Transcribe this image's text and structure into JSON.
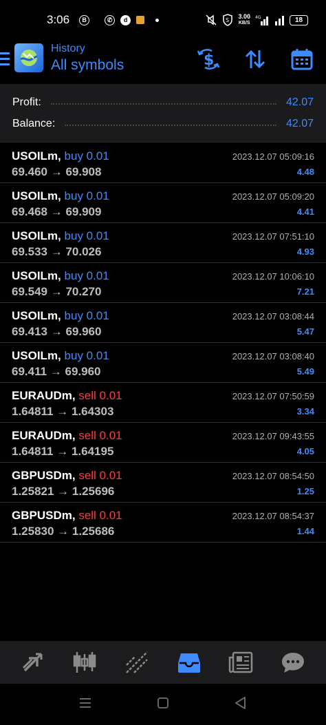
{
  "status_bar": {
    "time": "3:06",
    "network_speed_value": "3.00",
    "network_speed_unit": "KB/S",
    "network_type": "4G",
    "battery": "18"
  },
  "header": {
    "title_small": "History",
    "title_big": "All symbols"
  },
  "summary": {
    "profit_label": "Profit:",
    "profit_value": "42.07",
    "balance_label": "Balance:",
    "balance_value": "42.07"
  },
  "trades": [
    {
      "symbol": "USOILm,",
      "side": "buy 0.01",
      "type": "buy",
      "prices": "69.460 → 69.908",
      "date": "2023.12.07 05:09:16",
      "profit": "4.48"
    },
    {
      "symbol": "USOILm,",
      "side": "buy 0.01",
      "type": "buy",
      "prices": "69.468 → 69.909",
      "date": "2023.12.07 05:09:20",
      "profit": "4.41"
    },
    {
      "symbol": "USOILm,",
      "side": "buy 0.01",
      "type": "buy",
      "prices": "69.533 → 70.026",
      "date": "2023.12.07 07:51:10",
      "profit": "4.93"
    },
    {
      "symbol": "USOILm,",
      "side": "buy 0.01",
      "type": "buy",
      "prices": "69.549 → 70.270",
      "date": "2023.12.07 10:06:10",
      "profit": "7.21"
    },
    {
      "symbol": "USOILm,",
      "side": "buy 0.01",
      "type": "buy",
      "prices": "69.413 → 69.960",
      "date": "2023.12.07 03:08:44",
      "profit": "5.47"
    },
    {
      "symbol": "USOILm,",
      "side": "buy 0.01",
      "type": "buy",
      "prices": "69.411 → 69.960",
      "date": "2023.12.07 03:08:40",
      "profit": "5.49"
    },
    {
      "symbol": "EURAUDm,",
      "side": "sell 0.01",
      "type": "sell",
      "prices": "1.64811 → 1.64303",
      "date": "2023.12.07 07:50:59",
      "profit": "3.34"
    },
    {
      "symbol": "EURAUDm,",
      "side": "sell 0.01",
      "type": "sell",
      "prices": "1.64811 → 1.64195",
      "date": "2023.12.07 09:43:55",
      "profit": "4.05"
    },
    {
      "symbol": "GBPUSDm,",
      "side": "sell 0.01",
      "type": "sell",
      "prices": "1.25821 → 1.25696",
      "date": "2023.12.07 08:54:50",
      "profit": "1.25"
    },
    {
      "symbol": "GBPUSDm,",
      "side": "sell 0.01",
      "type": "sell",
      "prices": "1.25830 → 1.25686",
      "date": "2023.12.07 08:54:37",
      "profit": "1.44"
    }
  ],
  "bottom_nav": [
    {
      "icon": "quotes-icon",
      "active": false
    },
    {
      "icon": "chart-icon",
      "active": false
    },
    {
      "icon": "trade-icon",
      "active": false
    },
    {
      "icon": "history-icon",
      "active": true
    },
    {
      "icon": "news-icon",
      "active": false
    },
    {
      "icon": "chat-icon",
      "active": false
    }
  ],
  "colors": {
    "accent": "#3d8bff",
    "sell": "#ff3b3b",
    "background": "#000000",
    "panel": "#1b1b1d"
  }
}
